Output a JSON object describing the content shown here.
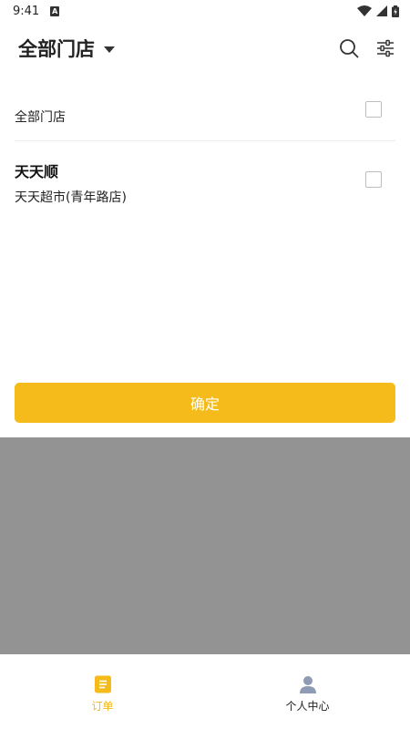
{
  "status_bar": {
    "time": "9:41",
    "notification_icon": "a-icon",
    "wifi_icon": "wifi-icon",
    "signal_icon": "signal-icon",
    "battery_icon": "battery-icon"
  },
  "header": {
    "title": "全部门店",
    "search_icon": "search-icon",
    "filter_icon": "filter-sliders-icon"
  },
  "list": {
    "all_label": "全部门店",
    "all_checked": false,
    "items": [
      {
        "brand": "天天顺",
        "store": "天天超市(青年路店)",
        "checked": false
      }
    ]
  },
  "confirm_label": "确定",
  "bottom_nav": {
    "items": [
      {
        "label": "订单",
        "icon": "order-icon",
        "active": true
      },
      {
        "label": "个人中心",
        "icon": "user-icon",
        "active": false
      }
    ]
  },
  "colors": {
    "accent": "#f4bb1a",
    "overlay": "#939393",
    "nav_inactive_icon": "#8f9bb3"
  }
}
